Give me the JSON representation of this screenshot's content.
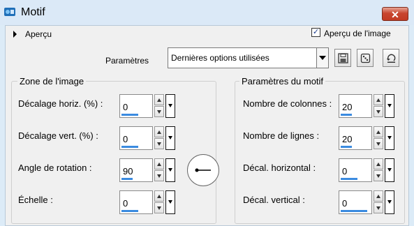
{
  "window": {
    "title": "Motif",
    "close_label": "✕"
  },
  "preview": {
    "label": "Aperçu",
    "checkbox_label": "Aperçu de l'image",
    "checked": true,
    "check_glyph": "✓"
  },
  "presets": {
    "label": "Paramètres",
    "selected": "Dernières options utilisées"
  },
  "toolbar": {
    "icons": [
      "save-icon",
      "random-dice-icon",
      "reset-icon"
    ]
  },
  "image_zone": {
    "title": "Zone de l'image",
    "fields": [
      {
        "label": "Décalage horiz. (%) :",
        "value": "0",
        "fill": 0.55
      },
      {
        "label": "Décalage vert. (%) :",
        "value": "0",
        "fill": 0.55
      },
      {
        "label": "Angle de rotation :",
        "value": "90",
        "fill": 0.35
      },
      {
        "label": "Échelle :",
        "value": "0",
        "fill": 0.55
      }
    ]
  },
  "pattern_params": {
    "title": "Paramètres du motif",
    "fields": [
      {
        "label": "Nombre de colonnes :",
        "value": "20",
        "fill": 0.35
      },
      {
        "label": "Nombre de lignes :",
        "value": "20",
        "fill": 0.35
      },
      {
        "label": "Décal. horizontal :",
        "value": "0",
        "fill": 0.55
      },
      {
        "label": "Décal. vertical :",
        "value": "0",
        "fill": 0.85
      }
    ]
  },
  "colors": {
    "accent": "#3b8be0",
    "title_bg": "#dbe9f7",
    "close": "#c8452f"
  }
}
